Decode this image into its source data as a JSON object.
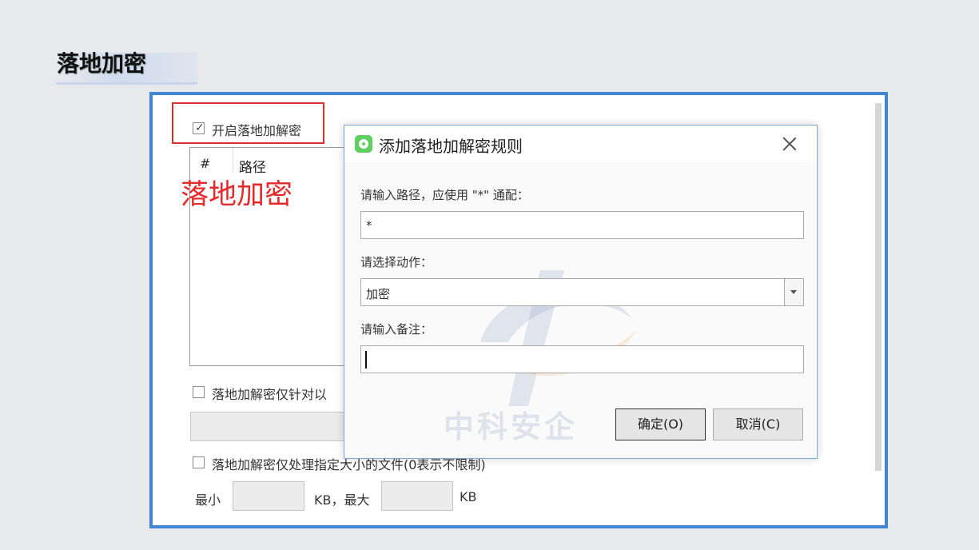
{
  "slide": {
    "title": "落地加密"
  },
  "main_panel": {
    "enable_checkbox": {
      "label": "开启落地加解密",
      "checked": true,
      "check_glyph": "✓"
    },
    "table": {
      "columns": [
        "#",
        "路径"
      ]
    },
    "annotation": "落地加密",
    "option1": {
      "label": "落地加解密仅针对以",
      "checked": false
    },
    "option2": {
      "label": "落地加解密仅处理指定大小的文件(0表示不限制)",
      "checked": false
    },
    "size_row": {
      "min_label": "最小",
      "mid_label": "KB，最大",
      "unit_label": "KB"
    }
  },
  "dialog": {
    "title": "添加落地加解密规则",
    "path_label": "请输入路径，应使用 \"*\" 通配：",
    "path_value": "*",
    "action_label": "请选择动作：",
    "action_value": "加密",
    "note_label": "请输入备注：",
    "note_value": "",
    "ok_label": "确定(O)",
    "cancel_label": "取消(C)",
    "watermark_text": "中科安企"
  },
  "colors": {
    "frame_border": "#3f86d6",
    "annotation_red": "#e52a2a",
    "app_icon": "#5fcf61"
  }
}
